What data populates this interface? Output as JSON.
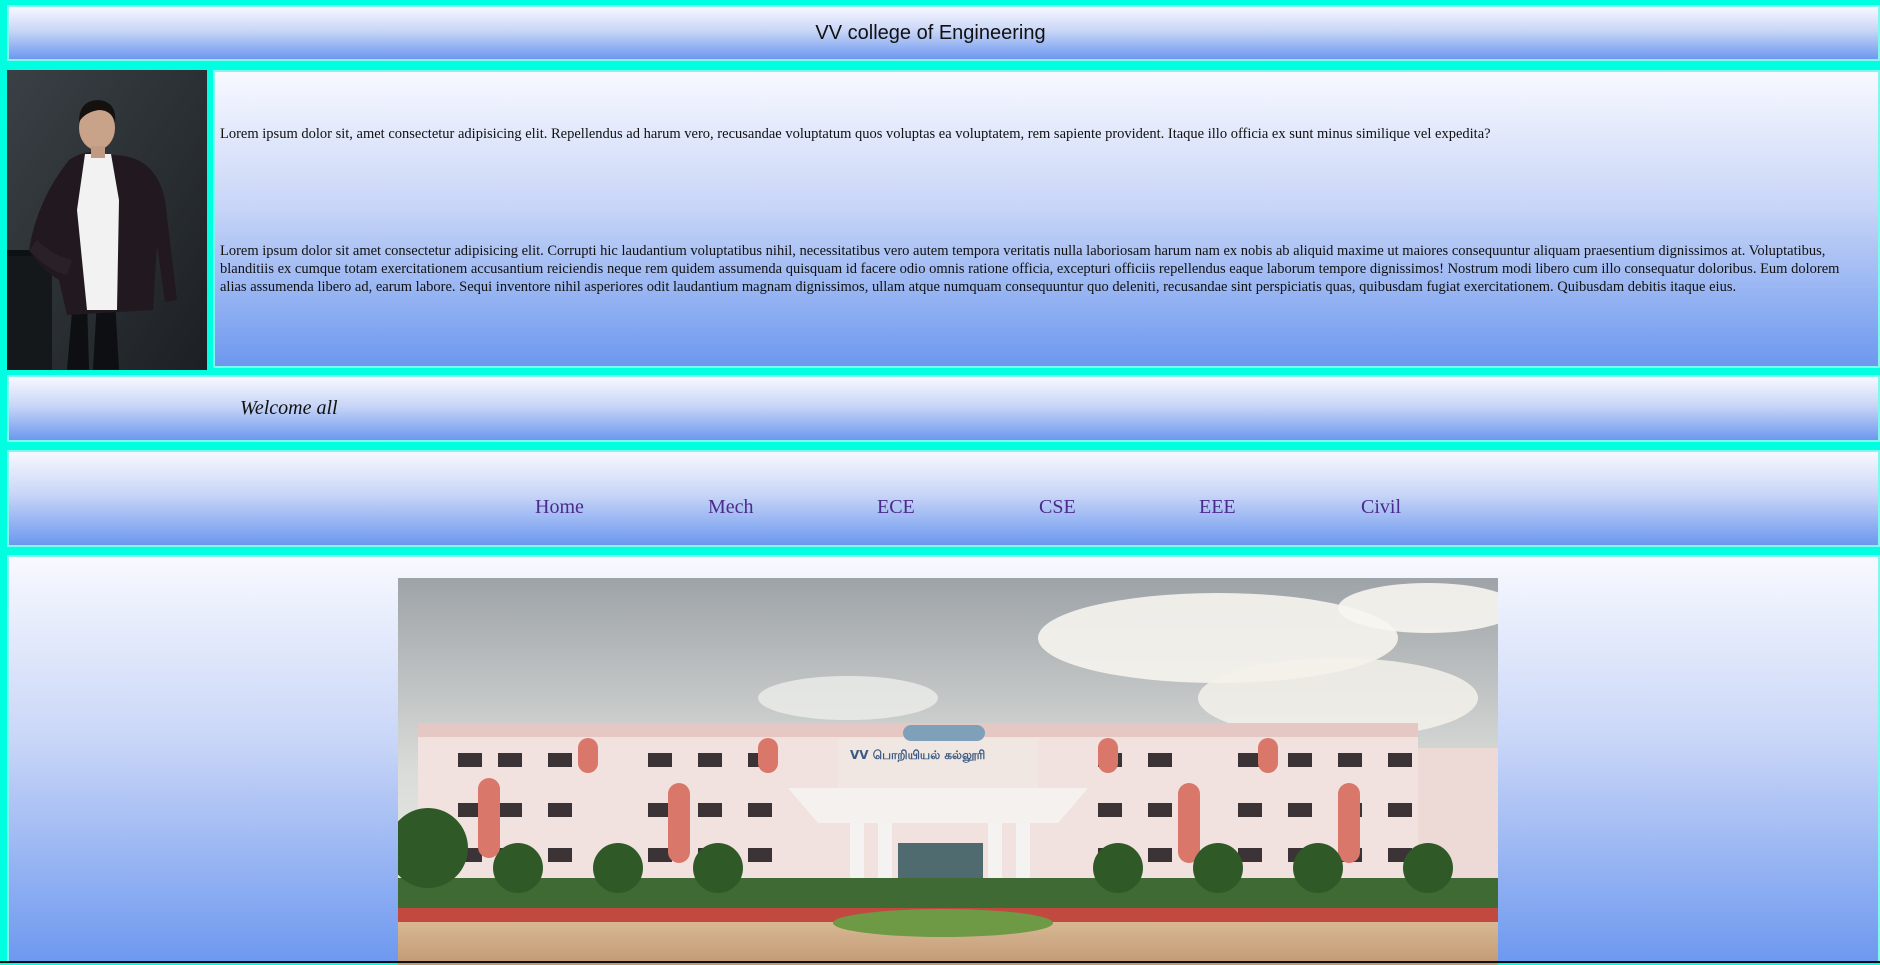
{
  "header": {
    "title": "VV college of Engineering"
  },
  "intro": {
    "paragraph1": "Lorem ipsum dolor sit, amet consectetur adipisicing elit. Repellendus ad harum vero, recusandae voluptatum quos voluptas ea voluptatem, rem sapiente provident. Itaque illo officia ex sunt minus similique vel expedita?",
    "paragraph2": "Lorem ipsum dolor sit amet consectetur adipisicing elit. Corrupti hic laudantium voluptatibus nihil, necessitatibus vero autem tempora veritatis nulla laboriosam harum nam ex nobis ab aliquid maxime ut maiores consequuntur aliquam praesentium dignissimos at. Voluptatibus, blanditiis ex cumque totam exercitationem accusantium reiciendis neque rem quidem assumenda quisquam id facere odio omnis ratione officia, excepturi officiis repellendus eaque laborum tempore dignissimos! Nostrum modi libero cum illo consequatur doloribus. Eum dolorem alias assumenda libero ad, earum labore. Sequi inventore nihil asperiores odit laudantium magnam dignissimos, ullam atque numquam consequuntur quo deleniti, recusandae sint perspiciatis quas, quibusdam fugiat exercitationem. Quibusdam debitis itaque eius."
  },
  "welcome": {
    "text": "Welcome all"
  },
  "nav": {
    "items": [
      {
        "label": "Home"
      },
      {
        "label": "Mech"
      },
      {
        "label": "ECE"
      },
      {
        "label": "CSE"
      },
      {
        "label": "EEE"
      },
      {
        "label": "Civil"
      }
    ]
  },
  "campus_photo": {
    "sign_text": "VV பொறியியல் கல்லூரி"
  },
  "colors": {
    "page_background": "#00ffe0",
    "gradient_top": "#f8f9ff",
    "gradient_bottom": "#6d98ef",
    "nav_link": "#4b2a8c"
  }
}
